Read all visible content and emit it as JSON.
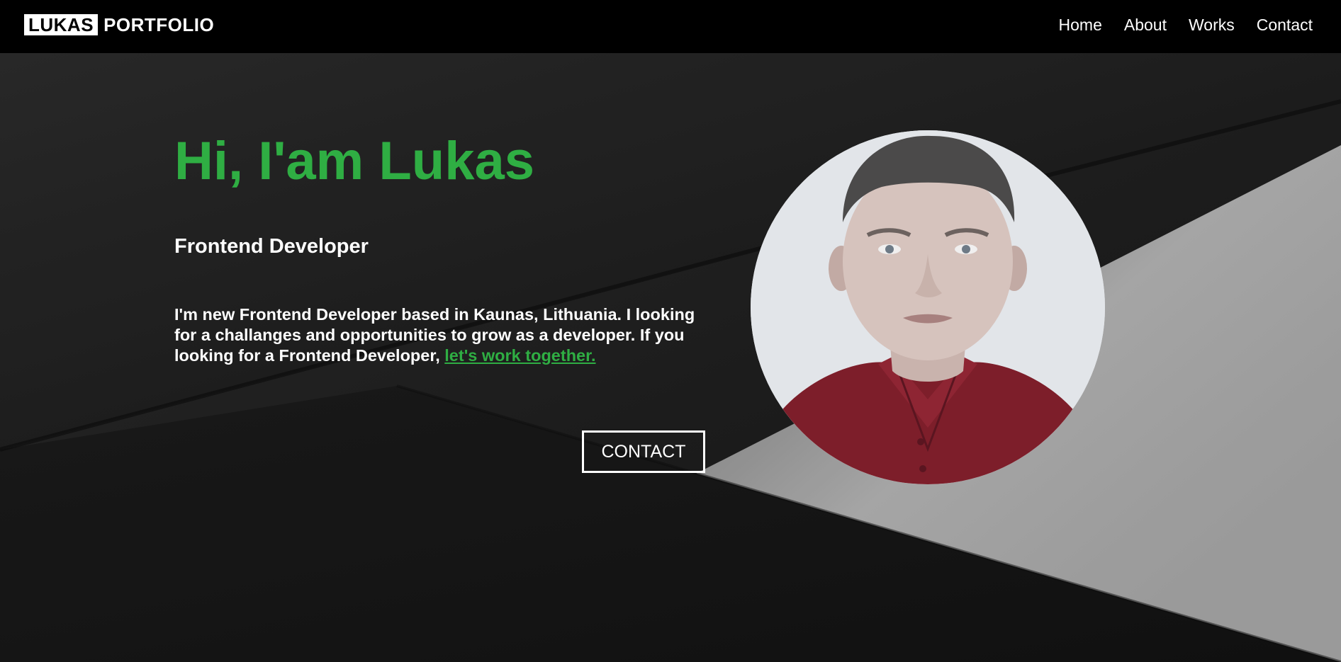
{
  "nav": {
    "logo_box": "LUKAS",
    "logo_text": "PORTFOLIO",
    "links": [
      "Home",
      "About",
      "Works",
      "Contact"
    ]
  },
  "hero": {
    "headline": "Hi, I'am Lukas",
    "role": "Frontend Developer",
    "bio_text": "I'm new Frontend Developer based in Kaunas, Lithuania. I looking for a challanges and opportunities to grow as a developer. If you looking for a Frontend Developer, ",
    "bio_link": "let's work together.",
    "contact_button": "CONTACT"
  },
  "colors": {
    "accent": "#2fae43",
    "navbar_bg": "#000000",
    "text": "#ffffff"
  }
}
